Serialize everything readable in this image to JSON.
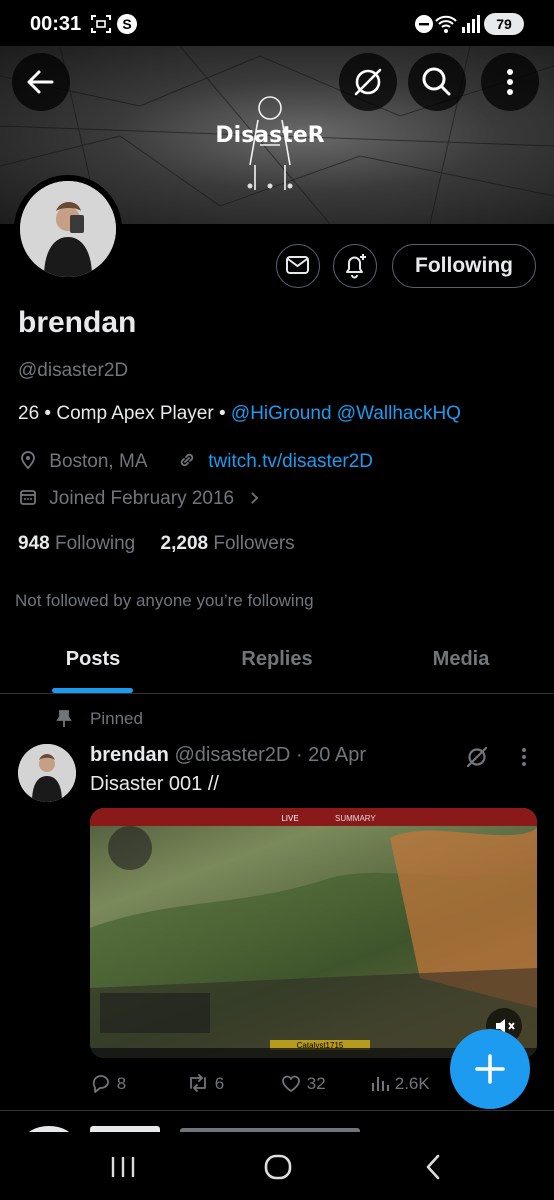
{
  "status_bar": {
    "time": "00:31",
    "battery": "79"
  },
  "banner": {
    "logo_text": "DisasteR"
  },
  "profile": {
    "name": "brendan",
    "handle": "@disaster2D",
    "bio_text": "26 • Comp Apex Player • ",
    "bio_link_1": "@HiGround",
    "bio_link_2": "@WallhackHQ",
    "location": "Boston, MA",
    "website": "twitch.tv/disaster2D",
    "joined": "Joined February 2016",
    "following_count": "948",
    "following_label": "Following",
    "followers_count": "2,208",
    "followers_label": "Followers",
    "not_followed": "Not followed by anyone you’re following",
    "follow_button": "Following"
  },
  "tabs": [
    "Posts",
    "Replies",
    "Media"
  ],
  "active_tab": "Posts",
  "post": {
    "pinned_label": "Pinned",
    "author_name": "brendan",
    "author_handle": "@disaster2D",
    "date": "· 20 Apr",
    "text": "Disaster 001 //",
    "replies": "8",
    "reposts": "6",
    "likes": "32",
    "views": "2.6K",
    "media_labels": {
      "live": "LIVE",
      "summary": "SUMMARY",
      "player": "Catalyst1715"
    }
  },
  "colors": {
    "accent": "#1d9bf0",
    "muted": "#71767b",
    "background": "#000000"
  },
  "icons": [
    "back-arrow-icon",
    "grok-icon",
    "search-icon",
    "more-icon",
    "mail-icon",
    "bell-plus-icon",
    "location-icon",
    "link-icon",
    "calendar-icon",
    "pin-icon",
    "reply-icon",
    "repost-icon",
    "like-icon",
    "views-icon",
    "plus-icon",
    "nav-recents-icon",
    "nav-home-icon",
    "nav-back-icon"
  ]
}
